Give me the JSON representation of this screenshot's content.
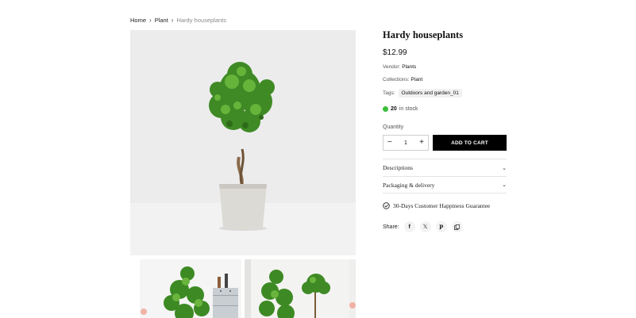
{
  "breadcrumb": {
    "home": "Home",
    "category": "Plant",
    "current": "Hardy houseplants"
  },
  "product": {
    "title": "Hardy houseplants",
    "price": "$12.99",
    "vendor_label": "Vendor:",
    "vendor_value": "Plants",
    "collections_label": "Collections:",
    "collections_value": "Plant",
    "tags_label": "Tags:",
    "tag": "Outdoors and garden_01",
    "stock_count": "20",
    "stock_text": "in stock",
    "stock_color": "#3bbf3b"
  },
  "purchase": {
    "quantity_label": "Quantity",
    "quantity_value": "1",
    "decrement": "−",
    "increment": "+",
    "add_to_cart": "ADD TO CART"
  },
  "accordions": [
    {
      "label": "Descriptions"
    },
    {
      "label": "Packaging & delivery"
    }
  ],
  "guarantee": "30-Days Customer Happiness Guarantee",
  "share": {
    "label": "Share:",
    "icons": [
      "facebook-icon",
      "x-icon",
      "pinterest-icon",
      "copy-link-icon"
    ]
  },
  "colors": {
    "accent": "#000000",
    "stock_dot": "#3bbf3b"
  }
}
